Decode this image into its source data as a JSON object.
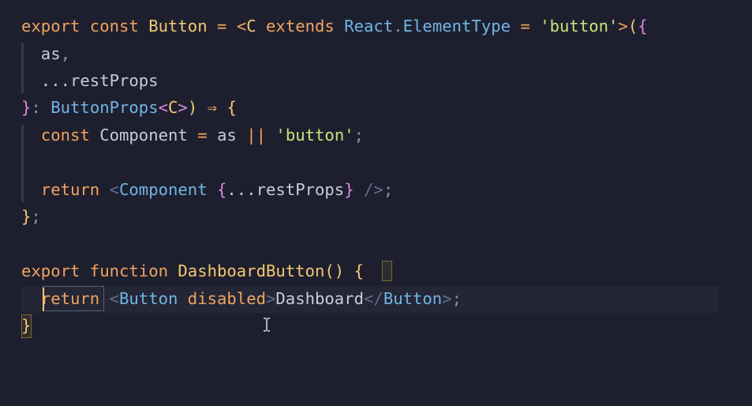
{
  "editor": {
    "lines": [
      {
        "tokens": [
          {
            "t": "export ",
            "c": "kw"
          },
          {
            "t": "const ",
            "c": "kw"
          },
          {
            "t": "Button",
            "c": "fn"
          },
          {
            "t": " = ",
            "c": "op"
          },
          {
            "t": "<",
            "c": "op"
          },
          {
            "t": "C",
            "c": "fn"
          },
          {
            "t": " extends ",
            "c": "kw"
          },
          {
            "t": "React",
            "c": "type"
          },
          {
            "t": ".",
            "c": "punc"
          },
          {
            "t": "ElementType",
            "c": "type"
          },
          {
            "t": " = ",
            "c": "op"
          },
          {
            "t": "'button'",
            "c": "str"
          },
          {
            "t": ">",
            "c": "op"
          },
          {
            "t": "(",
            "c": "br1"
          },
          {
            "t": "{",
            "c": "br2"
          }
        ]
      },
      {
        "tokens": [
          {
            "t": "  as",
            "c": "var"
          },
          {
            "t": ",",
            "c": "punc"
          }
        ]
      },
      {
        "tokens": [
          {
            "t": "  ...restProps",
            "c": "var"
          }
        ]
      },
      {
        "tokens": [
          {
            "t": "}",
            "c": "br2"
          },
          {
            "t": ": ",
            "c": "punc"
          },
          {
            "t": "ButtonProps",
            "c": "type"
          },
          {
            "t": "<",
            "c": "br2"
          },
          {
            "t": "C",
            "c": "fn"
          },
          {
            "t": ">",
            "c": "br2"
          },
          {
            "t": ")",
            "c": "br1"
          },
          {
            "t": " ⇒ ",
            "c": "op"
          },
          {
            "t": "{",
            "c": "br1"
          }
        ]
      },
      {
        "tokens": [
          {
            "t": "  const ",
            "c": "kw"
          },
          {
            "t": "Component",
            "c": "var"
          },
          {
            "t": " = ",
            "c": "op"
          },
          {
            "t": "as",
            "c": "var"
          },
          {
            "t": " || ",
            "c": "op"
          },
          {
            "t": "'button'",
            "c": "str"
          },
          {
            "t": ";",
            "c": "punc"
          }
        ]
      },
      {
        "tokens": []
      },
      {
        "tokens": [
          {
            "t": "  return ",
            "c": "kw"
          },
          {
            "t": "<",
            "c": "tagp"
          },
          {
            "t": "Component",
            "c": "tag"
          },
          {
            "t": " ",
            "c": "plain"
          },
          {
            "t": "{",
            "c": "br2"
          },
          {
            "t": "...restProps",
            "c": "var"
          },
          {
            "t": "}",
            "c": "br2"
          },
          {
            "t": " />",
            "c": "tagp"
          },
          {
            "t": ";",
            "c": "punc"
          }
        ]
      },
      {
        "tokens": [
          {
            "t": "}",
            "c": "br1"
          },
          {
            "t": ";",
            "c": "punc"
          }
        ]
      },
      {
        "tokens": []
      },
      {
        "tokens": [
          {
            "t": "export ",
            "c": "kw"
          },
          {
            "t": "function ",
            "c": "kw"
          },
          {
            "t": "DashboardButton",
            "c": "fn"
          },
          {
            "t": "() ",
            "c": "br1"
          },
          {
            "t": "{",
            "c": "br1"
          }
        ]
      },
      {
        "tokens": [
          {
            "t": "  return ",
            "c": "kw"
          },
          {
            "t": "<",
            "c": "tagp"
          },
          {
            "t": "Button",
            "c": "tag"
          },
          {
            "t": " disabled",
            "c": "attr"
          },
          {
            "t": ">",
            "c": "tagp"
          },
          {
            "t": "Dashboard",
            "c": "plain"
          },
          {
            "t": "</",
            "c": "tagp"
          },
          {
            "t": "Button",
            "c": "tag"
          },
          {
            "t": ">",
            "c": "tagp"
          },
          {
            "t": ";",
            "c": "punc"
          }
        ]
      },
      {
        "tokens": [
          {
            "t": "}",
            "c": "br1"
          }
        ]
      }
    ],
    "colors": {
      "background": "#1e1f2e",
      "keyword": "#f0a35e",
      "type": "#6fb5e5",
      "string": "#c4e57b",
      "bracket_level1": "#f3c970",
      "bracket_level2": "#d58be0"
    },
    "cursor_line": 11,
    "mouse_pointer": "text-cursor-icon"
  }
}
